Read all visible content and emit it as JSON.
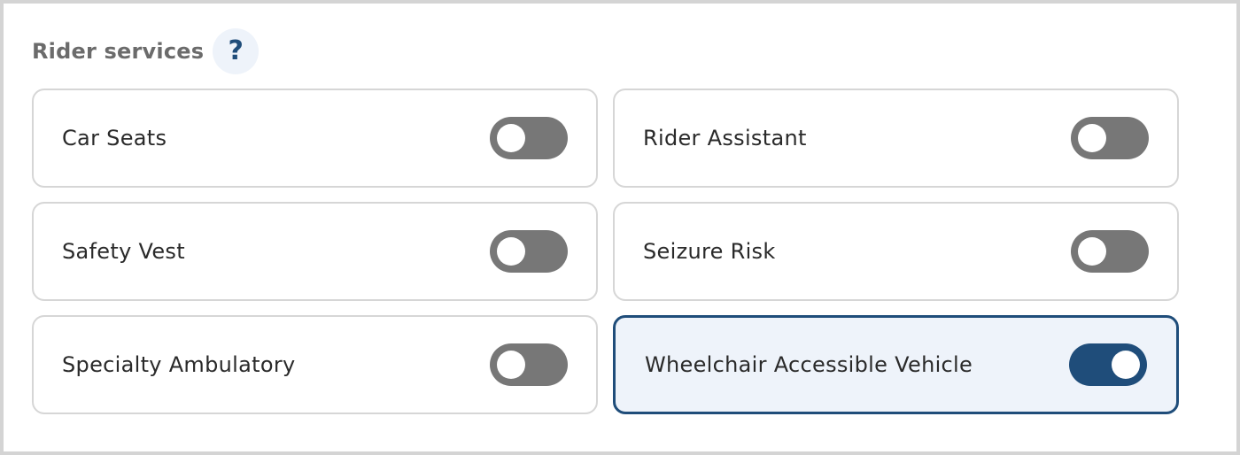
{
  "section": {
    "title": "Rider services",
    "help_icon": "?"
  },
  "services": [
    {
      "label": "Car Seats",
      "enabled": false
    },
    {
      "label": "Rider Assistant",
      "enabled": false
    },
    {
      "label": "Safety Vest",
      "enabled": false
    },
    {
      "label": "Seizure Risk",
      "enabled": false
    },
    {
      "label": "Specialty Ambulatory",
      "enabled": false
    },
    {
      "label": "Wheelchair Accessible Vehicle",
      "enabled": true
    }
  ],
  "colors": {
    "accent": "#1f4d7a",
    "toggle_off": "#777777",
    "active_card_bg": "#eef3fa",
    "card_border": "#d6d6d6"
  }
}
